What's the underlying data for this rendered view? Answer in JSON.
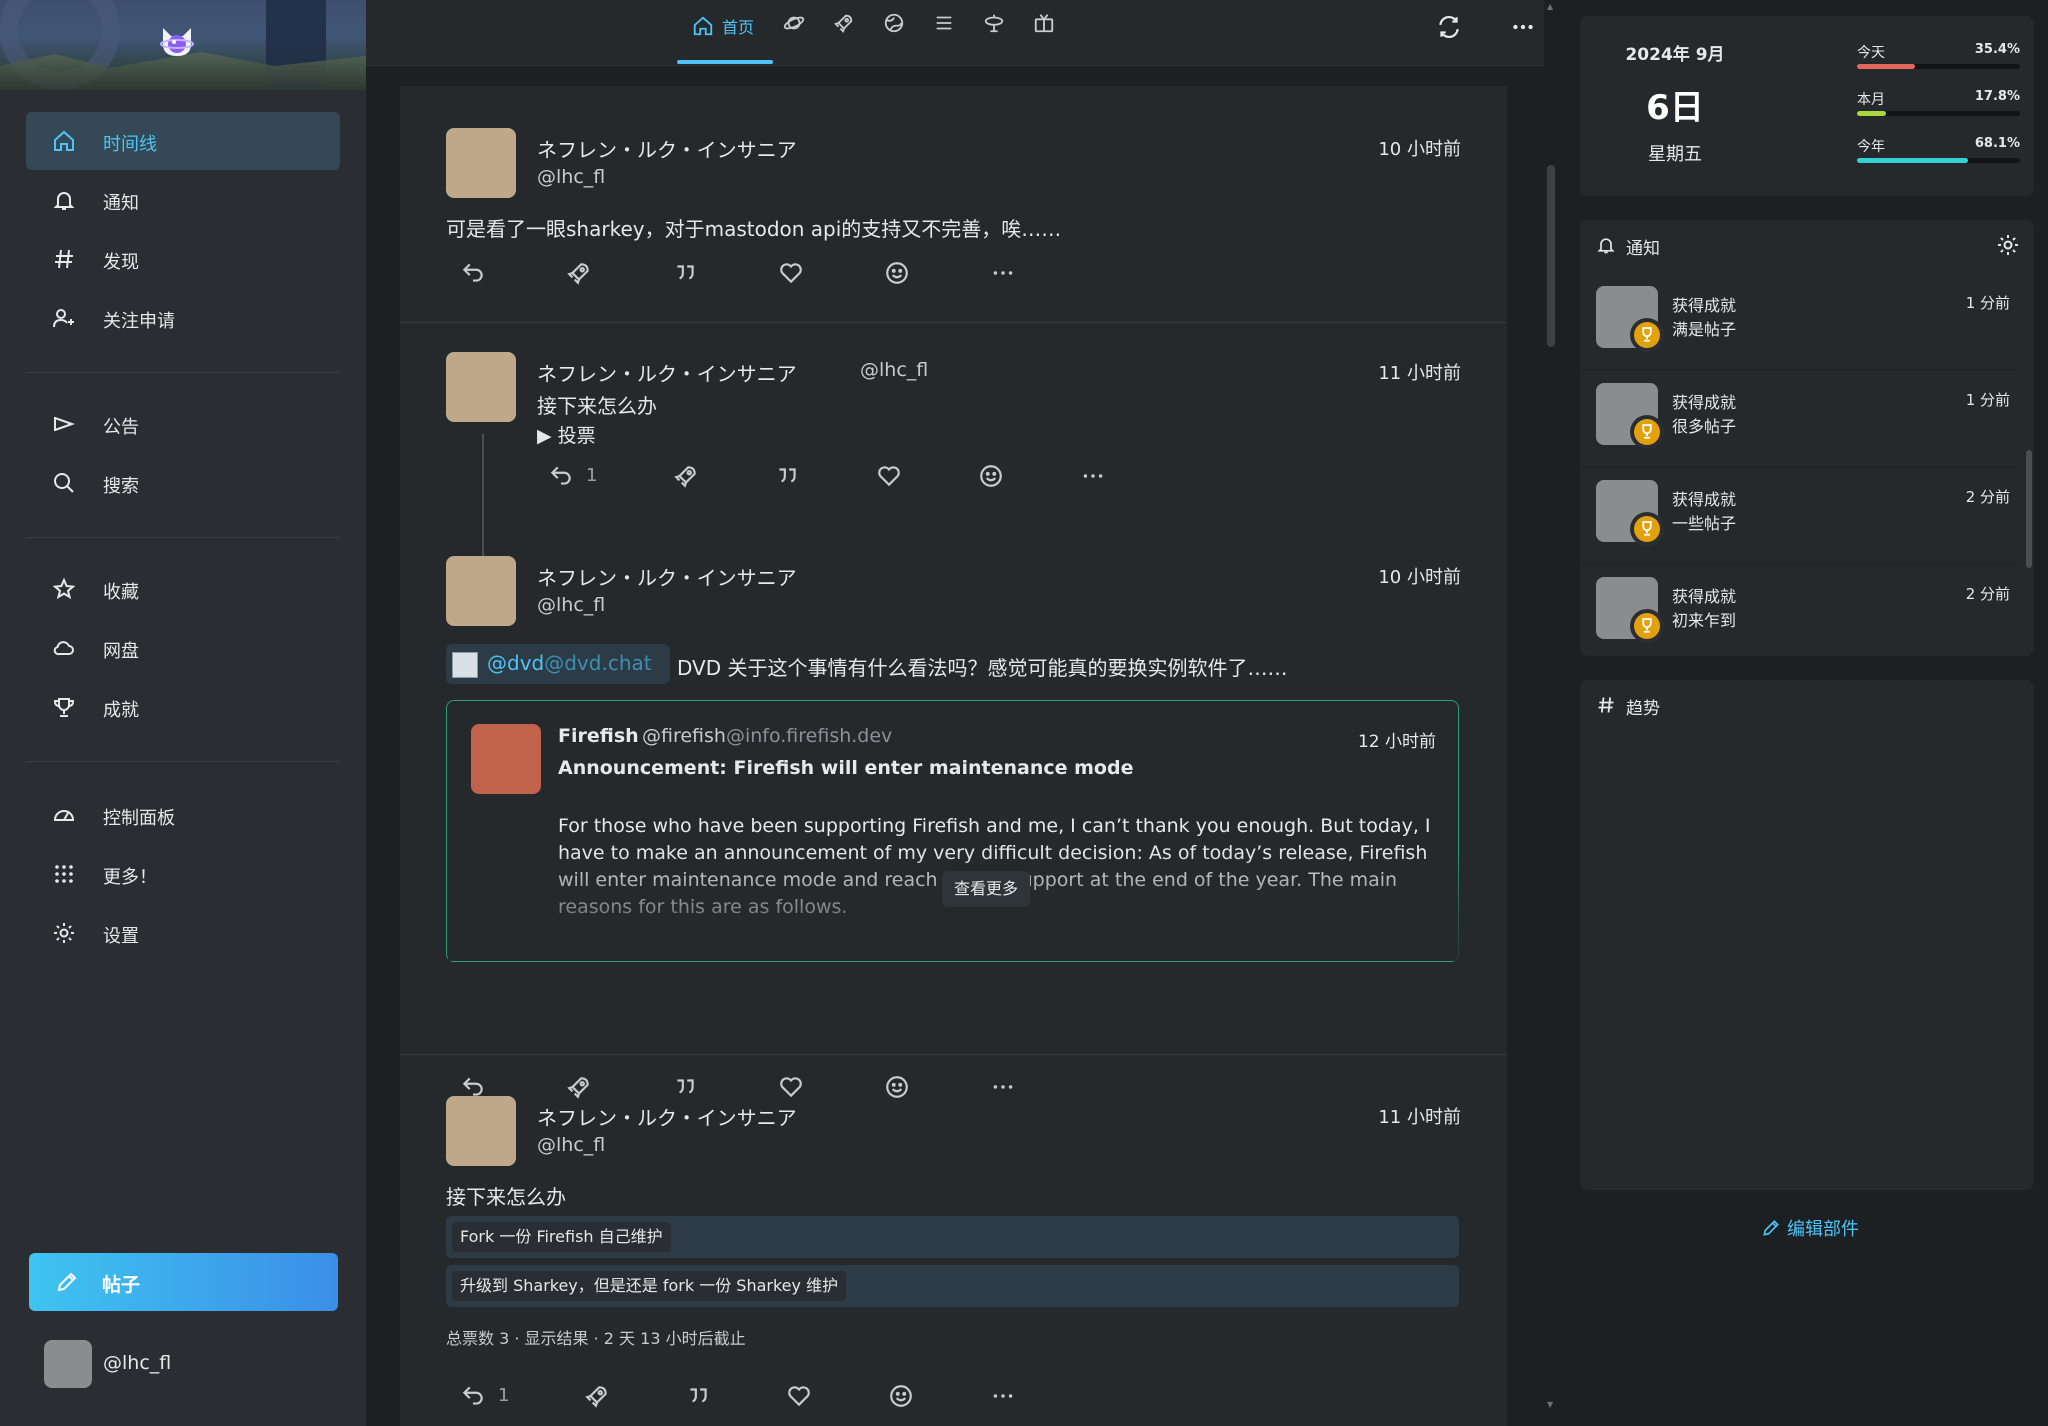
{
  "sidebar": {
    "items": [
      {
        "label": "时间线",
        "icon": "home-icon",
        "active": true
      },
      {
        "label": "通知",
        "icon": "bell-icon"
      },
      {
        "label": "发现",
        "icon": "hashtag-icon"
      },
      {
        "label": "关注申请",
        "icon": "user-plus-icon"
      },
      {
        "label": "公告",
        "icon": "megaphone-icon"
      },
      {
        "label": "搜索",
        "icon": "search-icon"
      },
      {
        "label": "收藏",
        "icon": "star-icon"
      },
      {
        "label": "网盘",
        "icon": "cloud-icon"
      },
      {
        "label": "成就",
        "icon": "trophy-icon"
      },
      {
        "label": "控制面板",
        "icon": "gauge-icon"
      },
      {
        "label": "更多！",
        "icon": "grid-dots-icon"
      },
      {
        "label": "设置",
        "icon": "gear-icon"
      }
    ],
    "post_button": "帖子",
    "account_handle": "@lhc_fl"
  },
  "topbar": {
    "home_tab_label": "首页",
    "tab_icons": [
      "home-icon",
      "planet-icon",
      "rocket-icon",
      "globe-icon",
      "list-icon",
      "antenna-icon",
      "tv-icon"
    ]
  },
  "timeline": {
    "post1": {
      "name": "ネフレン・ルク・インサニア",
      "handle": "@lhc_fl",
      "time": "10 小时前",
      "text": "可是看了一眼sharkey，对于mastodon api的支持又不完善，唉……"
    },
    "post2": {
      "name": "ネフレン・ルク・インサニア",
      "handle": "@lhc_fl",
      "time": "11 小时前",
      "text": "接下来怎么办",
      "poll_toggle": "▶ 投票",
      "reply_count": "1"
    },
    "post3": {
      "name": "ネフレン・ルク・インサニア",
      "handle": "@lhc_fl",
      "time": "10 小时前",
      "mention_user": "@dvd",
      "mention_host": "@dvd.chat",
      "text": "DVD 关于这个事情有什么看法吗？感觉可能真的要换实例软件了……",
      "quote": {
        "name": "Firefish",
        "handle": "@firefish",
        "host": "@info.firefish.dev",
        "time": "12 小时前",
        "title": "Announcement: Firefish will enter maintenance mode",
        "body": "For those who have been supporting Firefish and me, I can’t thank you enough. But today, I have to make an announcement of my very difficult decision: As of today’s release, Firefish will enter maintenance mode and reach end-of-support at the end of the year. The main reasons for this are as follows.",
        "show_more": "查看更多"
      }
    },
    "post4": {
      "name": "ネフレン・ルク・インサニア",
      "handle": "@lhc_fl",
      "time": "11 小时前",
      "text": "接下来怎么办",
      "poll_options": [
        "Fork 一份 Firefish 自己维护",
        "升级到 Sharkey，但是还是 fork 一份 Sharkey 维护"
      ],
      "poll_info": "总票数 3 · 显示结果 · 2 天 13 小时后截止",
      "reply_count": "1"
    }
  },
  "calendar": {
    "year_month": "2024年  9月",
    "day": "6日",
    "weekday": "星期五",
    "progress": [
      {
        "label": "今天",
        "value": "35.4%",
        "fraction": 0.354,
        "color": "#e2675d"
      },
      {
        "label": "本月",
        "value": "17.8%",
        "fraction": 0.178,
        "color": "#a8d83a"
      },
      {
        "label": "今年",
        "value": "68.1%",
        "fraction": 0.681,
        "color": "#33d1d6"
      }
    ]
  },
  "notifications": {
    "title": "通知",
    "items": [
      {
        "title": "获得成就",
        "subtitle": "满是帖子",
        "time": "1 分前"
      },
      {
        "title": "获得成就",
        "subtitle": "很多帖子",
        "time": "1 分前"
      },
      {
        "title": "获得成就",
        "subtitle": "一些帖子",
        "time": "2 分前"
      },
      {
        "title": "获得成就",
        "subtitle": "初来乍到",
        "time": "2 分前"
      }
    ]
  },
  "trends": {
    "title": "趋势"
  },
  "edit_widgets": "编辑部件",
  "colors": {
    "accent": "#4fc3f7",
    "active_bg": "#344955",
    "quote_border": "#2f9c74",
    "trophy": "#e3a20d"
  }
}
